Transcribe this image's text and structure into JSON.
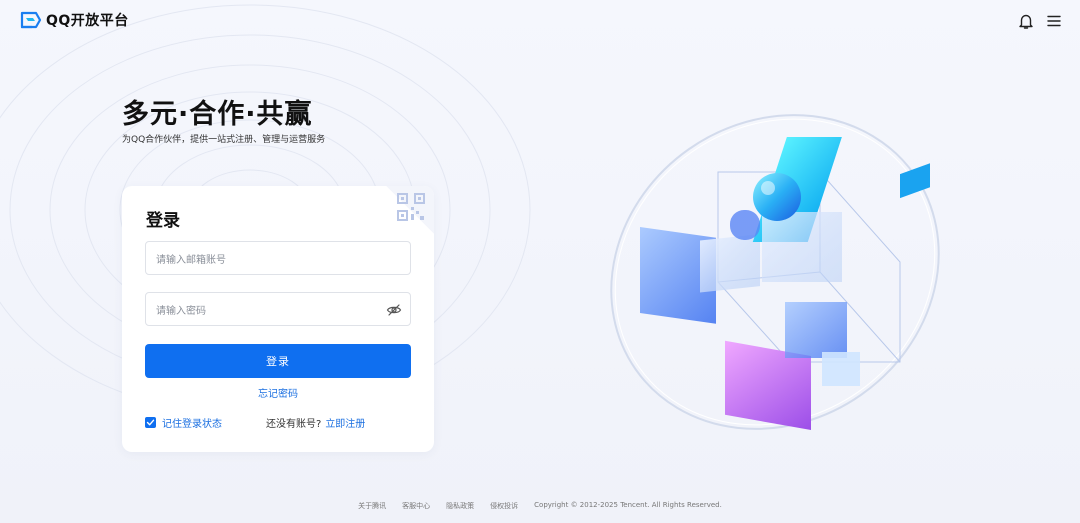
{
  "header": {
    "logo_text": "QQ开放平台",
    "icons": [
      "logo-icon",
      "bell-icon",
      "menu-icon"
    ]
  },
  "hero": {
    "title": "多元·合作·共赢",
    "subtitle": "为QQ合作伙伴，提供一站式注册、管理与运营服务"
  },
  "login": {
    "title": "登录",
    "email_placeholder": "请输入邮箱账号",
    "password_placeholder": "请输入密码",
    "submit_label": "登录",
    "forgot_label": "忘记密码",
    "remember_label": "记住登录状态",
    "remember_checked": true,
    "no_account_text": "还没有账号?",
    "register_link": "立即注册"
  },
  "footer": {
    "links": [
      "关于腾讯",
      "客服中心",
      "隐私政策",
      "侵权投诉"
    ],
    "copyright": "Copyright © 2012-2025 Tencent. All Rights Reserved."
  },
  "colors": {
    "accent": "#0f6ff0",
    "link": "#1b6fe0",
    "background": "#f3f5fb"
  }
}
